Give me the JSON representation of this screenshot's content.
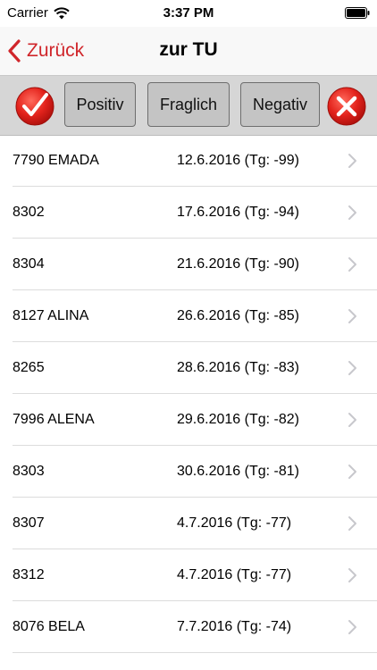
{
  "status_bar": {
    "carrier": "Carrier",
    "time": "3:37 PM",
    "wifi_icon": "wifi-icon",
    "battery_icon": "battery-icon"
  },
  "nav": {
    "back_label": "Zurück",
    "back_icon": "chevron-left-icon",
    "title": "zur TU"
  },
  "toolbar": {
    "confirm_icon": "checkmark-icon",
    "positiv_label": "Positiv",
    "fraglich_label": "Fraglich",
    "negativ_label": "Negativ",
    "cancel_icon": "close-icon"
  },
  "colors": {
    "accent": "#d0262b",
    "toolbar_bg": "#d6d6d6",
    "button_bg": "#c4c4c4"
  },
  "items": [
    {
      "name": "7790 EMADA",
      "date": "12.6.2016 (Tg: -99)"
    },
    {
      "name": "8302",
      "date": "17.6.2016 (Tg: -94)"
    },
    {
      "name": "8304",
      "date": "21.6.2016 (Tg: -90)"
    },
    {
      "name": "8127 ALINA",
      "date": "26.6.2016 (Tg: -85)"
    },
    {
      "name": "8265",
      "date": "28.6.2016 (Tg: -83)"
    },
    {
      "name": "7996 ALENA",
      "date": "29.6.2016 (Tg: -82)"
    },
    {
      "name": "8303",
      "date": "30.6.2016 (Tg: -81)"
    },
    {
      "name": "8307",
      "date": "4.7.2016 (Tg: -77)"
    },
    {
      "name": "8312",
      "date": "4.7.2016 (Tg: -77)"
    },
    {
      "name": "8076 BELA",
      "date": "7.7.2016 (Tg: -74)"
    }
  ]
}
